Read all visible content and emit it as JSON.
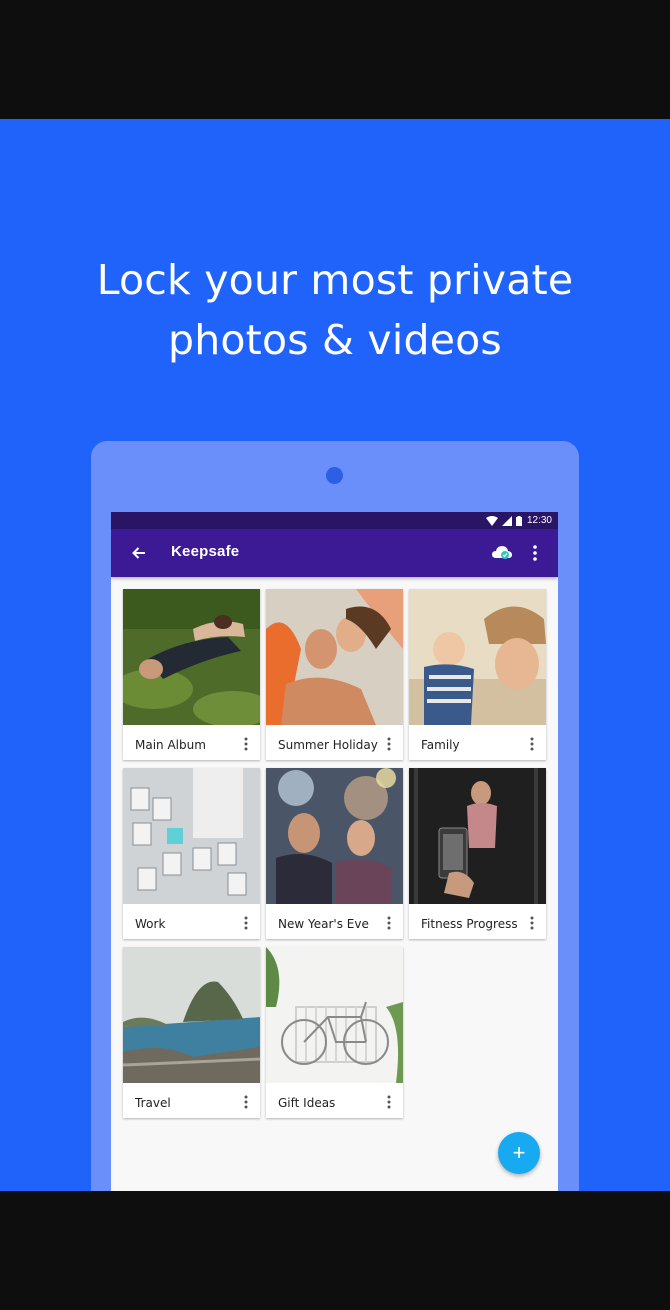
{
  "headline": {
    "line1": "Lock your most private",
    "line2": "photos & videos"
  },
  "status_bar": {
    "time": "12:30",
    "icons": [
      "wifi-icon",
      "signal-icon",
      "battery-icon"
    ]
  },
  "app_bar": {
    "title": "Keepsafe",
    "icons": [
      "back-arrow-icon",
      "cloud-sync-icon",
      "more-vert-icon"
    ]
  },
  "albums": [
    {
      "label": "Main Album",
      "icon": "more-vert-icon"
    },
    {
      "label": "Summer Holiday",
      "icon": "more-vert-icon"
    },
    {
      "label": "Family",
      "icon": "more-vert-icon"
    },
    {
      "label": "Work",
      "icon": "more-vert-icon"
    },
    {
      "label": "New Year's Eve",
      "icon": "more-vert-icon"
    },
    {
      "label": "Fitness Progress",
      "icon": "more-vert-icon"
    },
    {
      "label": "Travel",
      "icon": "more-vert-icon"
    },
    {
      "label": "Gift Ideas",
      "icon": "more-vert-icon"
    }
  ],
  "fab": {
    "label": "+",
    "icon": "add-icon"
  },
  "colors": {
    "background": "#1f63fb",
    "tablet": "#6a8ffb",
    "status_bar": "#2a1466",
    "app_bar": "#3c1a96",
    "fab": "#17aaf0",
    "letterbox": "#0e0e0e"
  }
}
